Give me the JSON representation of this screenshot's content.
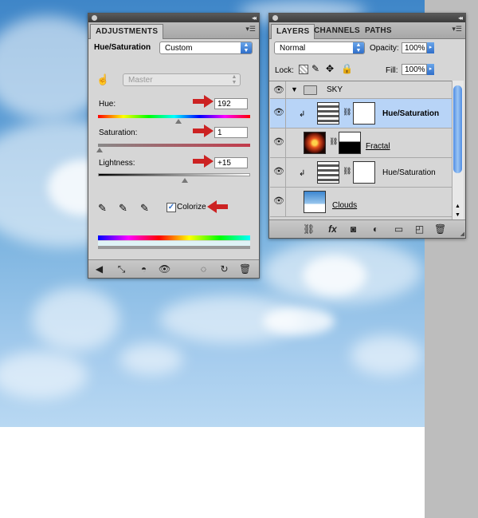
{
  "adjustments": {
    "tab": "ADJUSTMENTS",
    "title": "Hue/Saturation",
    "preset": "Custom",
    "channel": "Master",
    "hue_label": "Hue:",
    "hue_value": "192",
    "saturation_label": "Saturation:",
    "saturation_value": "1",
    "lightness_label": "Lightness:",
    "lightness_value": "+15",
    "colorize_label": "Colorize",
    "colorize_checked": true
  },
  "layers": {
    "tabs": [
      "LAYERS",
      "CHANNELS",
      "PATHS"
    ],
    "blend_mode": "Normal",
    "opacity_label": "Opacity:",
    "opacity_value": "100%",
    "lock_label": "Lock:",
    "fill_label": "Fill:",
    "fill_value": "100%",
    "group_name": "SKY",
    "rows": [
      {
        "name": "Hue/Saturation",
        "selected": true
      },
      {
        "name": "Fractal",
        "selected": false
      },
      {
        "name": "Hue/Saturation",
        "selected": false
      },
      {
        "name": "Clouds",
        "selected": false
      }
    ]
  },
  "colors": {
    "accent": "#2f6ec9",
    "highlight": "#b8d4f7",
    "arrow": "#cc2222"
  }
}
